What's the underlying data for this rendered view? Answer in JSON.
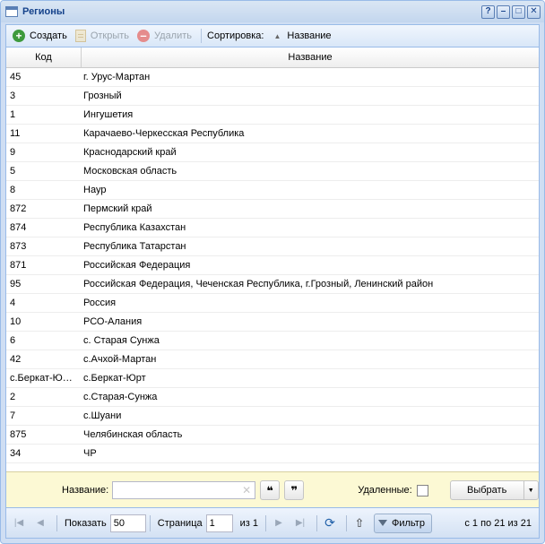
{
  "window": {
    "title": "Регионы",
    "tools": {
      "help": "?",
      "minimize": "–",
      "maximize": "□",
      "close": "✕"
    }
  },
  "toolbar": {
    "create": "Создать",
    "open": "Открыть",
    "delete": "Удалить",
    "sort_label": "Сортировка:",
    "sort_field": "Название"
  },
  "grid": {
    "columns": [
      "Код",
      "Название"
    ],
    "rows": [
      [
        "45",
        "г. Урус-Мартан"
      ],
      [
        "3",
        "Грозный"
      ],
      [
        "1",
        "Ингушетия"
      ],
      [
        "11",
        "Карачаево-Черкесская Республика"
      ],
      [
        "9",
        "Краснодарский край"
      ],
      [
        "5",
        "Московская область"
      ],
      [
        "8",
        "Наур"
      ],
      [
        "872",
        "Пермский край"
      ],
      [
        "874",
        "Республика Казахстан"
      ],
      [
        "873",
        "Республика Татарстан"
      ],
      [
        "871",
        "Российская Федерация"
      ],
      [
        "95",
        "Российская Федерация, Чеченская Республика, г.Грозный, Ленинский район"
      ],
      [
        "4",
        "Россия"
      ],
      [
        "10",
        "РСО-Алания"
      ],
      [
        "6",
        "с. Старая Сунжа"
      ],
      [
        "42",
        "с.Ачхой-Мартан"
      ],
      [
        "с.Беркат-Ю…",
        "с.Беркат-Юрт"
      ],
      [
        "2",
        "с.Старая-Сунжа"
      ],
      [
        "7",
        "с.Шуани"
      ],
      [
        "875",
        "Челябинская область"
      ],
      [
        "34",
        "ЧР"
      ]
    ]
  },
  "filter": {
    "name_label": "Название:",
    "name_value": "",
    "quote_open": "❝",
    "quote_close": "❞",
    "deleted_label": "Удаленные:",
    "select_button": "Выбрать"
  },
  "pager": {
    "show_label": "Показать",
    "page_size": "50",
    "page_label": "Страница",
    "page": "1",
    "of_label": "из 1",
    "filter_button": "Фильтр",
    "info": "с 1 по 21 из 21"
  }
}
